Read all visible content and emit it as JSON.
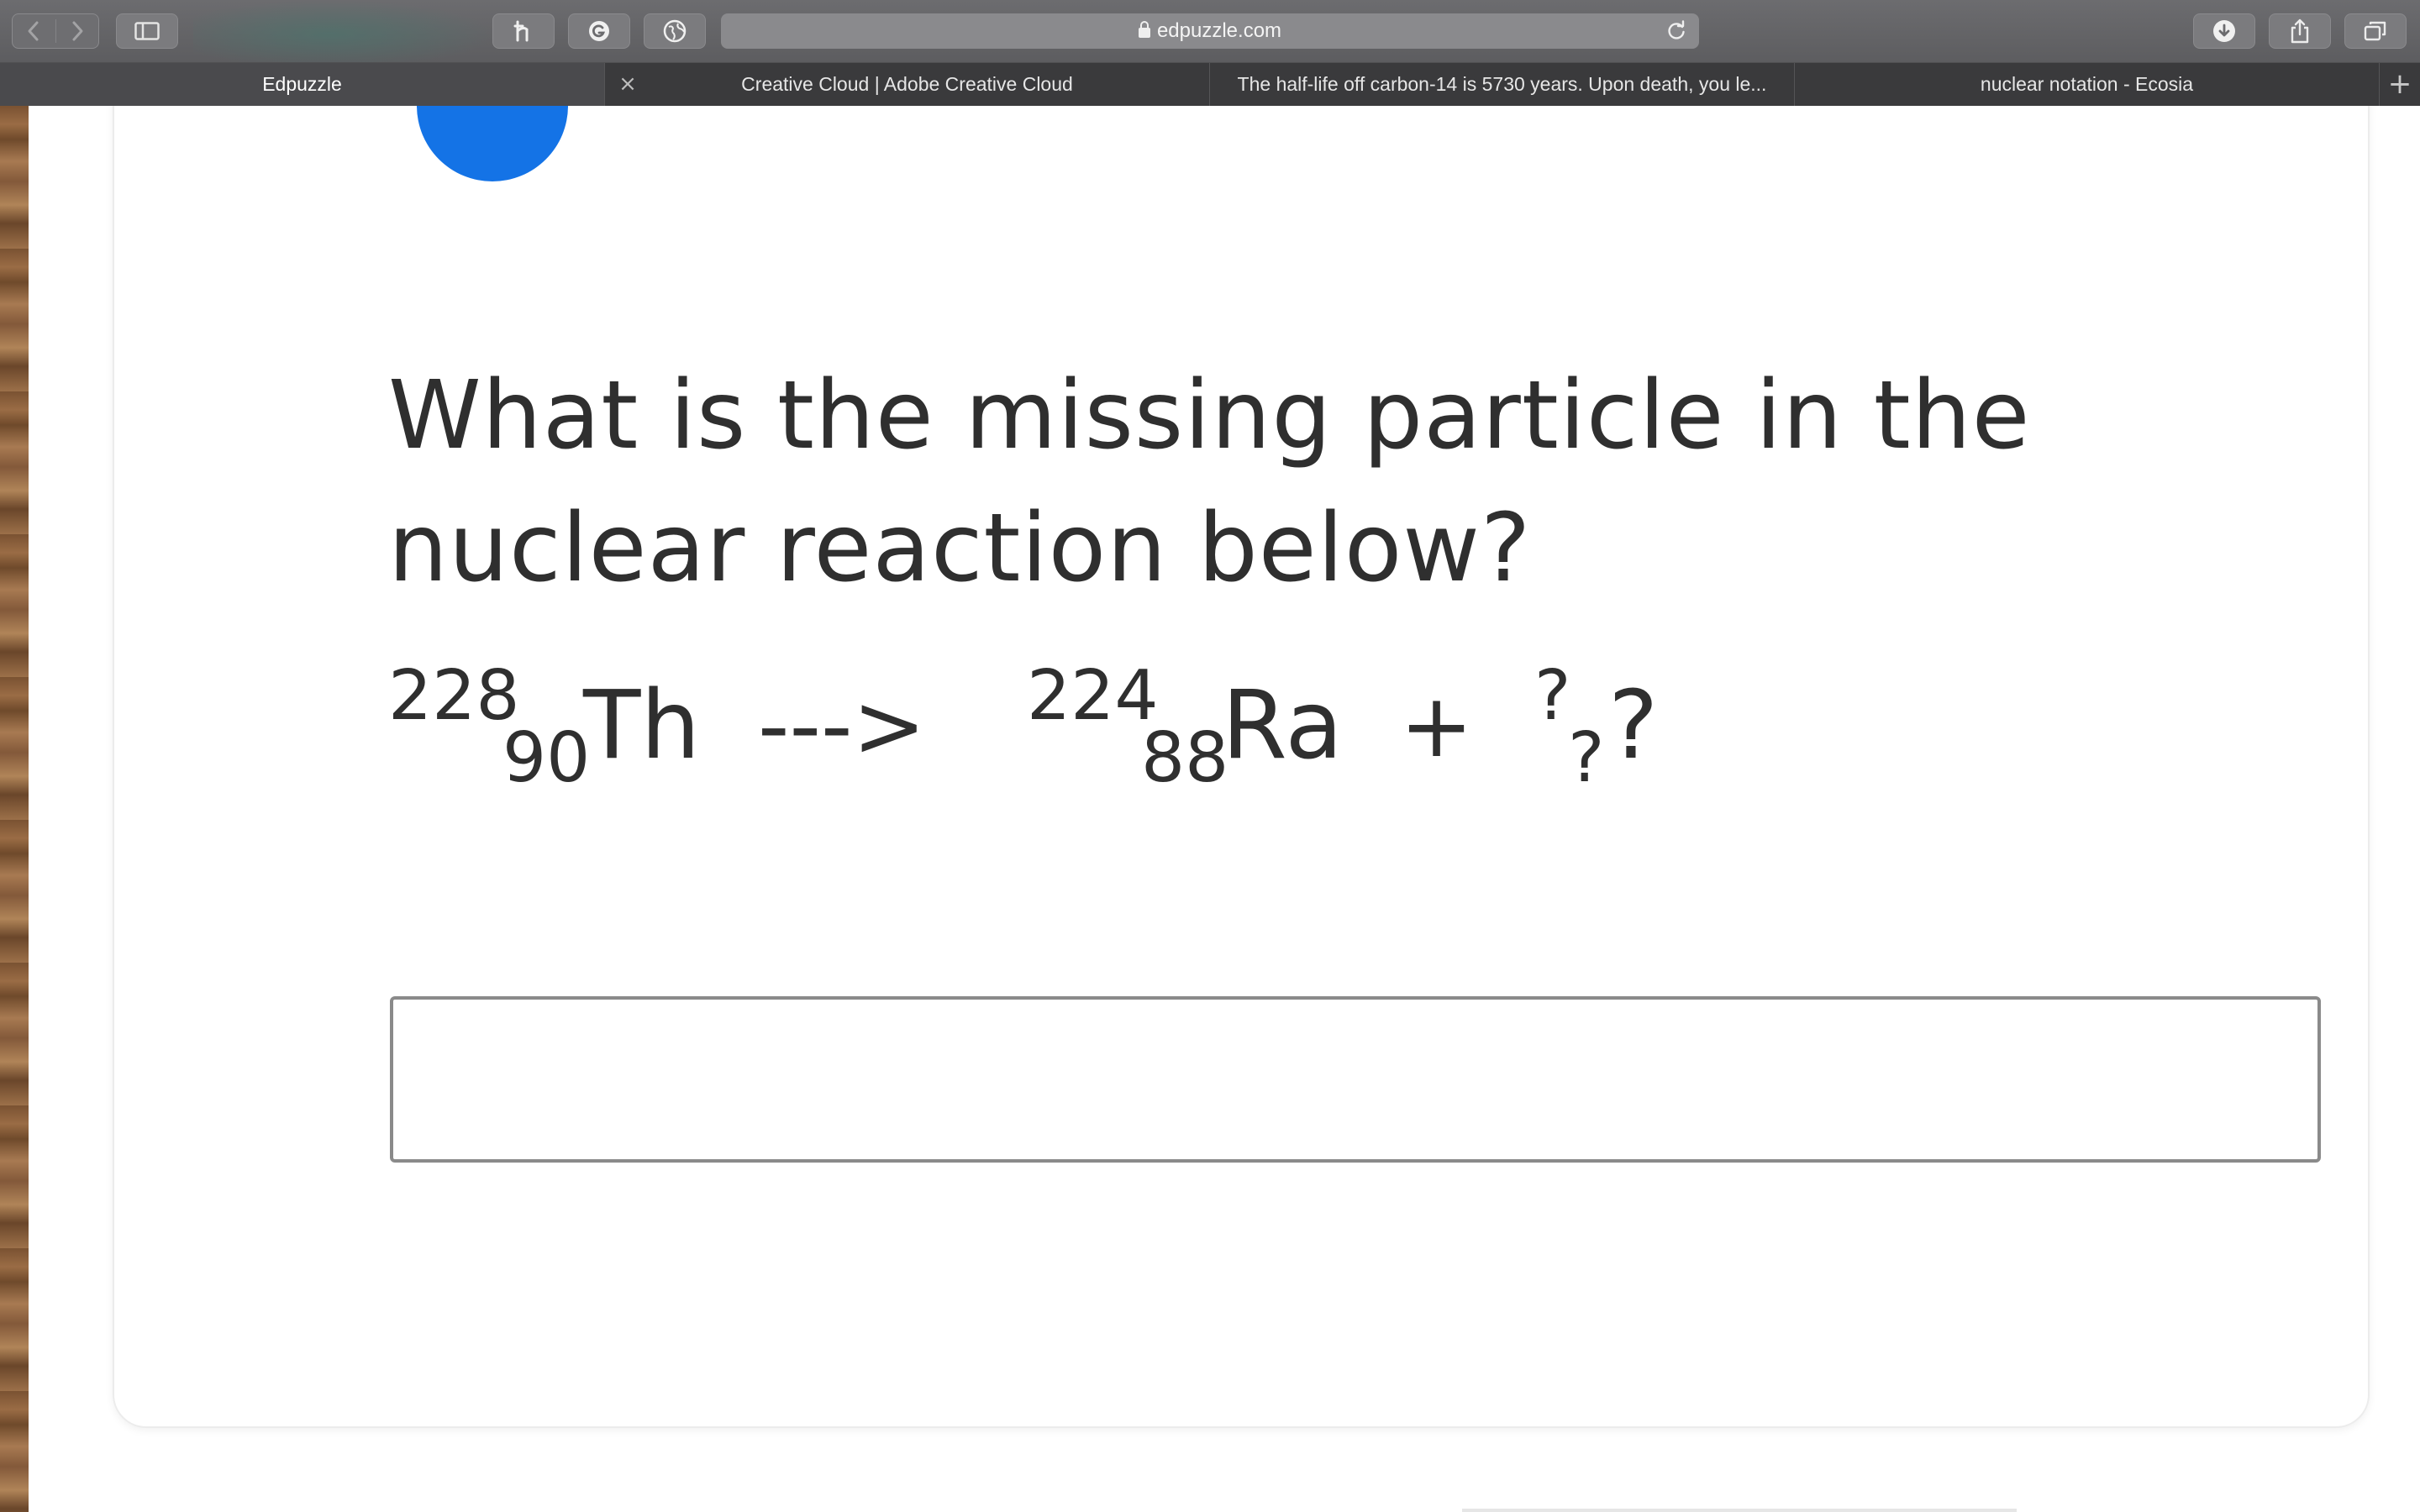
{
  "browser": {
    "url": "edpuzzle.com",
    "tabs": [
      {
        "label": "Edpuzzle",
        "active": true
      },
      {
        "label": "Creative Cloud | Adobe Creative Cloud",
        "active": false
      },
      {
        "label": "The half-life off carbon-14 is 5730 years. Upon death, you le...",
        "active": false
      },
      {
        "label": "nuclear notation - Ecosia",
        "active": false
      }
    ],
    "toolbar_icons": [
      "back-icon",
      "forward-icon",
      "sidebar-icon",
      "honey-extension-icon",
      "grammarly-extension-icon",
      "globe-extension-icon",
      "download-icon",
      "share-icon",
      "tabs-overview-icon"
    ],
    "new_tab_symbol": "+",
    "tab_close_symbol": "×"
  },
  "question": {
    "text": "What is the missing particle in the nuclear reaction below?",
    "reactant": {
      "mass": "228",
      "atomic": "90",
      "symbol": "Th"
    },
    "arrow": "--->",
    "product": {
      "mass": "224",
      "atomic": "88",
      "symbol": "Ra"
    },
    "plus": "+",
    "unknown": {
      "mass": "?",
      "atomic": "?",
      "symbol": "?"
    }
  },
  "answer": {
    "value": "",
    "placeholder": ""
  },
  "colors": {
    "accent": "#1473e6",
    "text": "#2f2f2f",
    "input_border": "#8a8a8a"
  }
}
